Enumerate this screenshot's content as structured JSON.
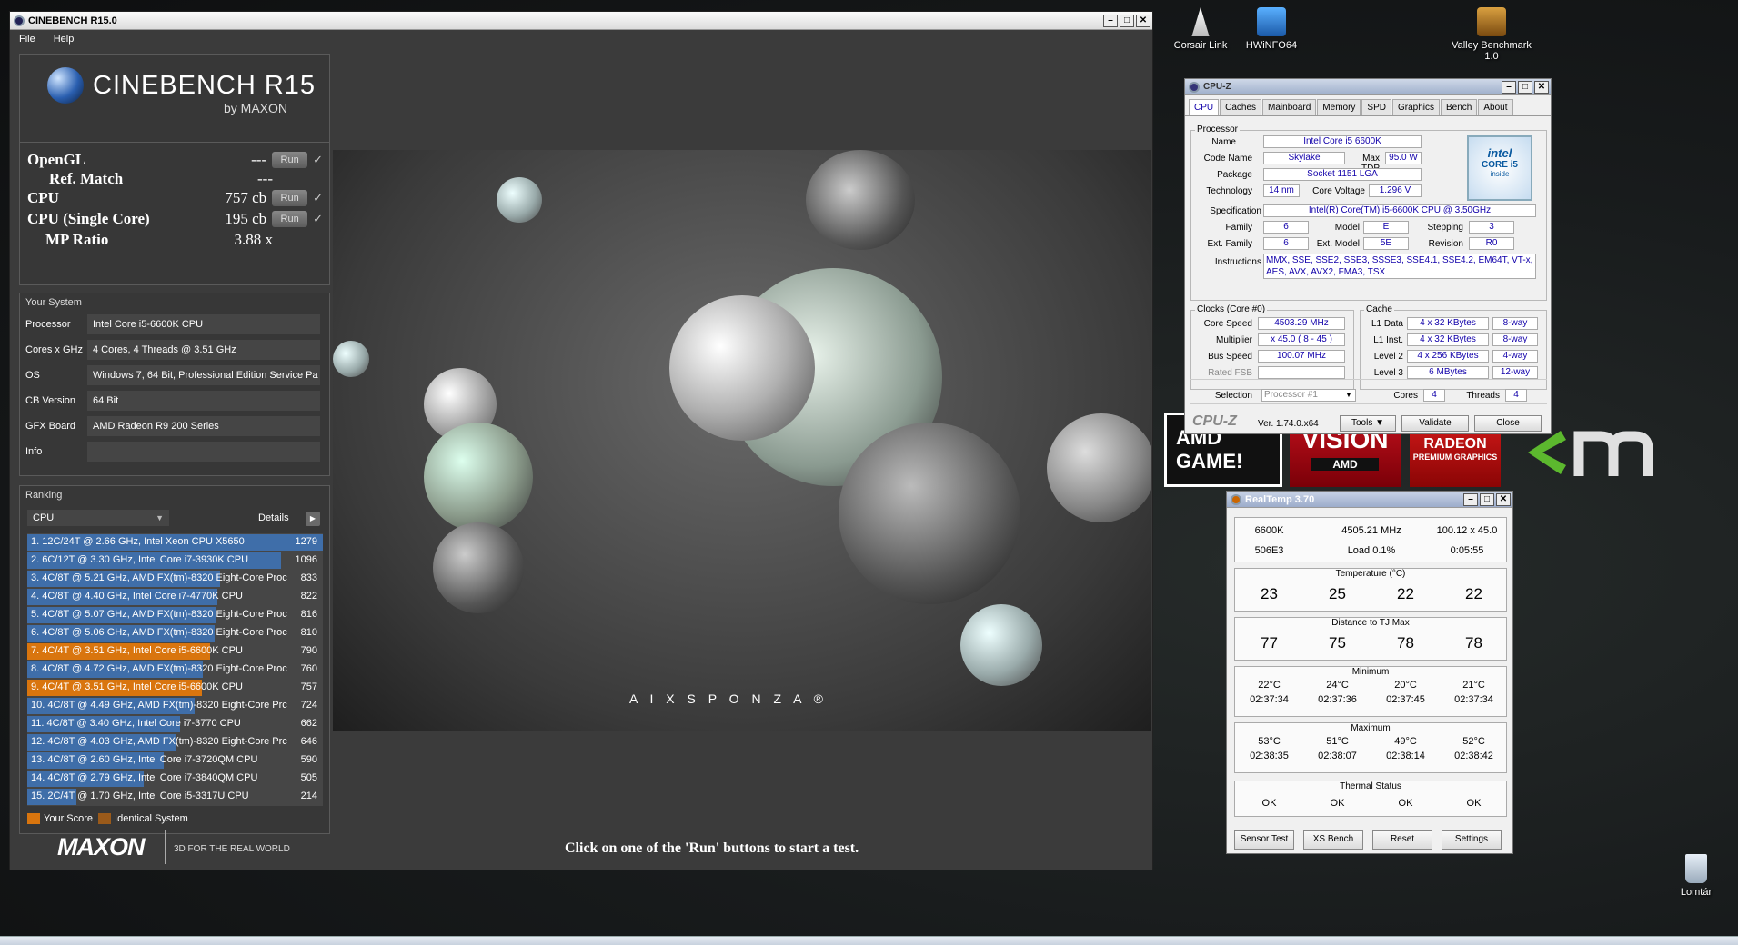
{
  "desktop": {
    "icons": [
      {
        "label": "Corsair Link"
      },
      {
        "label": "HWiNFO64"
      },
      {
        "label": "Valley Benchmark 1.0"
      },
      {
        "label": "Lomtár"
      }
    ],
    "banner_amd": "AMD GAME!",
    "banner_vision": "VISION",
    "banner_vision_sub": "AMD",
    "banner_radeon": "RADEON",
    "banner_radeon_sub": "PREMIUM GRAPHICS"
  },
  "cinebench": {
    "title": "CINEBENCH R15.0",
    "menu": [
      "File",
      "Help"
    ],
    "logo_main": "CINEBENCH R15",
    "logo_sub": "by MAXON",
    "scores": [
      {
        "label": "OpenGL",
        "value": "---",
        "run": "Run",
        "check": "✓"
      },
      {
        "label": "Ref. Match",
        "value": "---"
      },
      {
        "label": "CPU",
        "value": "757 cb",
        "run": "Run",
        "check": "✓"
      },
      {
        "label": "CPU (Single Core)",
        "value": "195 cb",
        "run": "Run",
        "check": "✓"
      },
      {
        "label": "MP Ratio",
        "value": "3.88 x"
      }
    ],
    "your_system": {
      "title": "Your System",
      "rows": [
        {
          "k": "Processor",
          "v": "Intel Core i5-6600K CPU"
        },
        {
          "k": "Cores x GHz",
          "v": "4 Cores, 4 Threads @ 3.51 GHz"
        },
        {
          "k": "OS",
          "v": "Windows 7, 64 Bit, Professional Edition Service Pa"
        },
        {
          "k": "CB Version",
          "v": "64 Bit"
        },
        {
          "k": "GFX Board",
          "v": "AMD Radeon R9 200 Series"
        },
        {
          "k": "Info",
          "v": ""
        }
      ]
    },
    "ranking": {
      "title": "Ranking",
      "select": "CPU",
      "details": "Details",
      "rows": [
        {
          "t": "1. 12C/24T @ 2.66 GHz, Intel Xeon CPU X5650",
          "s": "1279",
          "frac": 1.0,
          "me": false
        },
        {
          "t": "2. 6C/12T @ 3.30 GHz,  Intel Core i7-3930K CPU",
          "s": "1096",
          "frac": 0.857,
          "me": false
        },
        {
          "t": "3. 4C/8T @ 5.21 GHz, AMD FX(tm)-8320 Eight-Core Proc",
          "s": "833",
          "frac": 0.651,
          "me": false
        },
        {
          "t": "4. 4C/8T @ 4.40 GHz, Intel Core i7-4770K CPU",
          "s": "822",
          "frac": 0.643,
          "me": false
        },
        {
          "t": "5. 4C/8T @ 5.07 GHz, AMD FX(tm)-8320 Eight-Core Proc",
          "s": "816",
          "frac": 0.638,
          "me": false
        },
        {
          "t": "6. 4C/8T @ 5.06 GHz, AMD FX(tm)-8320 Eight-Core Proc",
          "s": "810",
          "frac": 0.633,
          "me": false
        },
        {
          "t": "7. 4C/4T @ 3.51 GHz, Intel Core i5-6600K CPU",
          "s": "790",
          "frac": 0.618,
          "me": true
        },
        {
          "t": "8. 4C/8T @ 4.72 GHz, AMD FX(tm)-8320 Eight-Core Proc",
          "s": "760",
          "frac": 0.594,
          "me": false
        },
        {
          "t": "9. 4C/4T @ 3.51 GHz, Intel Core i5-6600K CPU",
          "s": "757",
          "frac": 0.592,
          "me": true
        },
        {
          "t": "10. 4C/8T @ 4.49 GHz, AMD FX(tm)-8320 Eight-Core Prc",
          "s": "724",
          "frac": 0.566,
          "me": false
        },
        {
          "t": "11. 4C/8T @ 3.40 GHz,  Intel Core i7-3770 CPU",
          "s": "662",
          "frac": 0.518,
          "me": false
        },
        {
          "t": "12. 4C/8T @ 4.03 GHz, AMD FX(tm)-8320 Eight-Core Prc",
          "s": "646",
          "frac": 0.505,
          "me": false
        },
        {
          "t": "13. 4C/8T @ 2.60 GHz, Intel Core i7-3720QM CPU",
          "s": "590",
          "frac": 0.461,
          "me": false
        },
        {
          "t": "14. 4C/8T @ 2.79 GHz,  Intel Core i7-3840QM CPU",
          "s": "505",
          "frac": 0.395,
          "me": false
        },
        {
          "t": "15. 2C/4T @ 1.70 GHz,  Intel Core i5-3317U CPU",
          "s": "214",
          "frac": 0.167,
          "me": false
        }
      ],
      "legend_your": "Your Score",
      "legend_identical": "Identical System"
    },
    "maxon": "MAXON",
    "maxon_tag": "3D FOR THE REAL WORLD",
    "render_credit": "A I X S P O N Z A ®",
    "status": "Click on one of the 'Run' buttons to start a test."
  },
  "cpuz": {
    "title": "CPU-Z",
    "tabs": [
      "CPU",
      "Caches",
      "Mainboard",
      "Memory",
      "SPD",
      "Graphics",
      "Bench",
      "About"
    ],
    "processor_title": "Processor",
    "name_l": "Name",
    "name": "Intel Core i5 6600K",
    "codename_l": "Code Name",
    "codename": "Skylake",
    "maxtdp_l": "Max TDP",
    "maxtdp": "95.0 W",
    "package_l": "Package",
    "package": "Socket 1151 LGA",
    "tech_l": "Technology",
    "tech": "14 nm",
    "cv_l": "Core Voltage",
    "cv": "1.296 V",
    "spec_l": "Specification",
    "spec": "Intel(R) Core(TM) i5-6600K CPU @ 3.50GHz",
    "family_l": "Family",
    "family": "6",
    "model_l": "Model",
    "model": "E",
    "stepping_l": "Stepping",
    "stepping": "3",
    "extfam_l": "Ext. Family",
    "extfam": "6",
    "extmodel_l": "Ext. Model",
    "extmodel": "5E",
    "rev_l": "Revision",
    "rev": "R0",
    "instr_l": "Instructions",
    "instr": "MMX, SSE, SSE2, SSE3, SSSE3, SSE4.1, SSE4.2, EM64T, VT-x, AES, AVX, AVX2, FMA3, TSX",
    "intel_badge": "intel",
    "intel_core": "CORE i5",
    "intel_inside": "inside",
    "clocks_title": "Clocks (Core #0)",
    "cs_l": "Core Speed",
    "cs": "4503.29 MHz",
    "mult_l": "Multiplier",
    "mult": "x 45.0 ( 8 - 45 )",
    "bus_l": "Bus Speed",
    "bus": "100.07 MHz",
    "fsb_l": "Rated FSB",
    "fsb": "",
    "cache_title": "Cache",
    "l1d_l": "L1 Data",
    "l1d": "4 x 32 KBytes",
    "l1d_w": "8-way",
    "l1i_l": "L1 Inst.",
    "l1i": "4 x 32 KBytes",
    "l1i_w": "8-way",
    "l2_l": "Level 2",
    "l2": "4 x 256 KBytes",
    "l2_w": "4-way",
    "l3_l": "Level 3",
    "l3": "6 MBytes",
    "l3_w": "12-way",
    "sel_l": "Selection",
    "sel": "Processor #1",
    "cores_l": "Cores",
    "cores": "4",
    "threads_l": "Threads",
    "threads": "4",
    "brand": "CPU-Z",
    "ver": "Ver. 1.74.0.x64",
    "tools": "Tools",
    "validate": "Validate",
    "close": "Close"
  },
  "realtemp": {
    "title": "RealTemp 3.70",
    "cpu": "6600K",
    "freq": "4505.21 MHz",
    "mult": "100.12 x 45.0",
    "id": "506E3",
    "load": "Load  0.1%",
    "time": "0:05:55",
    "temp_title": "Temperature (°C)",
    "temps": [
      "23",
      "25",
      "22",
      "22"
    ],
    "dist_title": "Distance to TJ Max",
    "dist": [
      "77",
      "75",
      "78",
      "78"
    ],
    "min_title": "Minimum",
    "min": [
      "22°C",
      "24°C",
      "20°C",
      "21°C"
    ],
    "min_t": [
      "02:37:34",
      "02:37:36",
      "02:37:45",
      "02:37:34"
    ],
    "max_title": "Maximum",
    "max": [
      "53°C",
      "51°C",
      "49°C",
      "52°C"
    ],
    "max_t": [
      "02:38:35",
      "02:38:07",
      "02:38:14",
      "02:38:42"
    ],
    "status_title": "Thermal Status",
    "status": [
      "OK",
      "OK",
      "OK",
      "OK"
    ],
    "buttons": [
      "Sensor Test",
      "XS Bench",
      "Reset",
      "Settings"
    ]
  }
}
